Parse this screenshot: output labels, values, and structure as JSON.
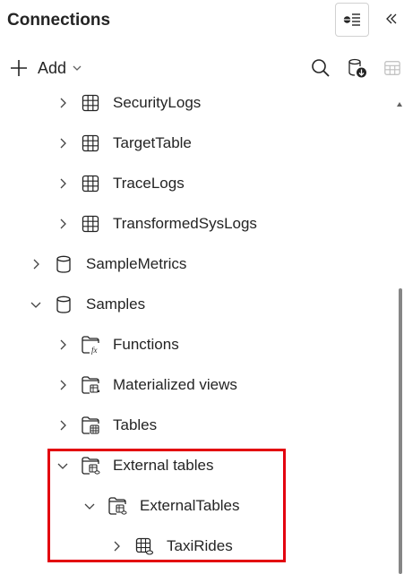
{
  "header": {
    "title": "Connections"
  },
  "toolbar": {
    "add_label": "Add"
  },
  "tree": {
    "items": [
      {
        "label": "SecurityLogs",
        "expanded": false,
        "icon": "table-icon"
      },
      {
        "label": "TargetTable",
        "expanded": false,
        "icon": "table-icon"
      },
      {
        "label": "TraceLogs",
        "expanded": false,
        "icon": "table-icon"
      },
      {
        "label": "TransformedSysLogs",
        "expanded": false,
        "icon": "table-icon"
      },
      {
        "label": "SampleMetrics",
        "expanded": false,
        "icon": "database-icon"
      },
      {
        "label": "Samples",
        "expanded": true,
        "icon": "database-icon"
      },
      {
        "label": "Functions",
        "expanded": false,
        "icon": "functions-folder-icon"
      },
      {
        "label": "Materialized views",
        "expanded": false,
        "icon": "materialized-views-folder-icon"
      },
      {
        "label": "Tables",
        "expanded": false,
        "icon": "tables-folder-icon"
      },
      {
        "label": "External tables",
        "expanded": true,
        "icon": "external-tables-folder-icon"
      },
      {
        "label": "ExternalTables",
        "expanded": true,
        "icon": "external-tables-folder-icon"
      },
      {
        "label": "TaxiRides",
        "expanded": false,
        "icon": "external-table-icon"
      }
    ]
  },
  "colors": {
    "highlight": "#e3000f",
    "text": "#242424"
  }
}
